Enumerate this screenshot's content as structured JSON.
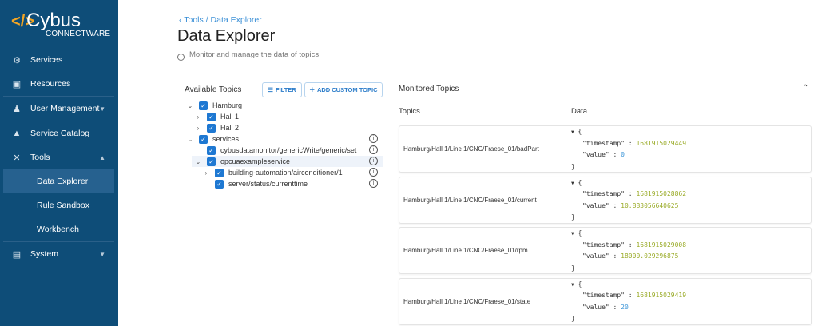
{
  "sidebar": {
    "brand": "Cybus",
    "brand_sub": "CONNECTWARE",
    "items": [
      {
        "label": "Services",
        "icon": "gears-icon"
      },
      {
        "label": "Resources",
        "icon": "chip-icon"
      },
      {
        "label": "User Management",
        "icon": "users-gear-icon"
      },
      {
        "label": "Service Catalog",
        "icon": "shapes-icon"
      },
      {
        "label": "Tools",
        "icon": "tools-icon"
      },
      {
        "label": "Data Explorer"
      },
      {
        "label": "Rule Sandbox"
      },
      {
        "label": "Workbench"
      },
      {
        "label": "System",
        "icon": "chart-icon"
      }
    ]
  },
  "breadcrumb": {
    "parent": "Tools",
    "sep": "/",
    "current": "Data Explorer"
  },
  "page": {
    "title": "Data Explorer",
    "description": "Monitor and manage the data of topics"
  },
  "available": {
    "title": "Available Topics",
    "filter": "FILTER",
    "add": "ADD CUSTOM TOPIC",
    "tree": [
      "Hamburg",
      "Hall 1",
      "Hall 2",
      "services",
      "cybusdatamonitor/genericWrite/generic/set",
      "opcuaexampleservice",
      "building-automation/airconditioner/1",
      "server/status/currenttime"
    ]
  },
  "monitored": {
    "title": "Monitored Topics",
    "col_topics": "Topics",
    "col_data": "Data",
    "rows": [
      {
        "topic": "Hamburg/Hall 1/Line 1/CNC/Fraese_01/badPart",
        "timestamp": "1681915029449",
        "value": "0"
      },
      {
        "topic": "Hamburg/Hall 1/Line 1/CNC/Fraese_01/current",
        "timestamp": "1681915028862",
        "value": "10.883056640625"
      },
      {
        "topic": "Hamburg/Hall 1/Line 1/CNC/Fraese_01/rpm",
        "timestamp": "1681915029008",
        "value": "18000.029296875"
      },
      {
        "topic": "Hamburg/Hall 1/Line 1/CNC/Fraese_01/state",
        "timestamp": "1681915029419",
        "value": "20"
      }
    ]
  },
  "colors": {
    "sidebar": "#0e4d78",
    "accent": "#1e78d2",
    "logo": "#f5a623"
  }
}
